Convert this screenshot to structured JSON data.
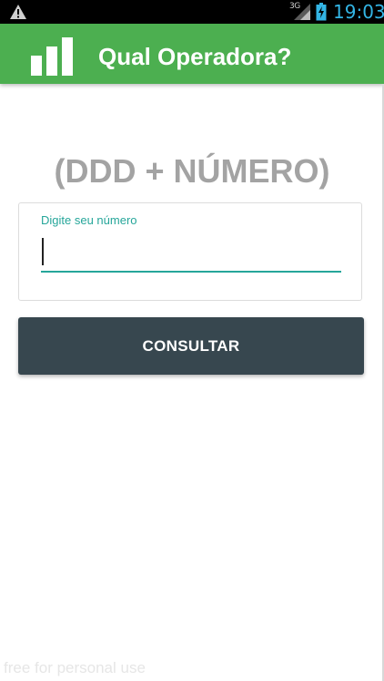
{
  "status_bar": {
    "network": "3G",
    "time": "19:03",
    "icons": [
      "warning-icon",
      "signal-icon",
      "battery-charging-icon"
    ]
  },
  "app_bar": {
    "title": "Qual Operadora?",
    "logo_icon": "bar-chart-logo-icon",
    "color": "#4caf50"
  },
  "main": {
    "heading": "(DDD + NÚMERO)",
    "input": {
      "label": "Digite seu número",
      "value": "",
      "accent_color": "#26a69a"
    },
    "button": {
      "label": "CONSULTAR",
      "color": "#37474f"
    }
  },
  "watermark": "free for personal use"
}
